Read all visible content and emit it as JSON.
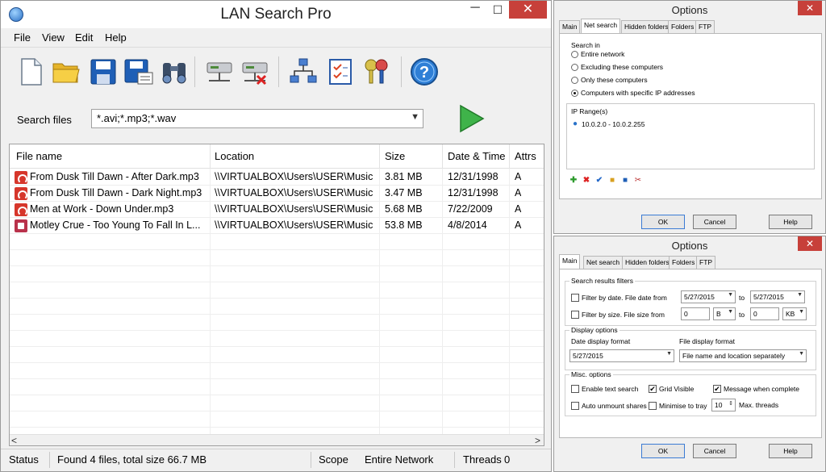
{
  "window": {
    "title": "LAN Search Pro",
    "close": "✕",
    "minimize": "─",
    "maximize": "☐"
  },
  "menu": {
    "file": "File",
    "view": "View",
    "edit": "Edit",
    "help": "Help"
  },
  "toolbar": {
    "icons": [
      "new-file-icon",
      "open-folder-icon",
      "save-icon",
      "save-as-icon",
      "find-binoculars-icon",
      "map-drive-icon",
      "disconnect-drive-icon",
      "network-icon",
      "checklist-icon",
      "keys-icon",
      "help-icon"
    ]
  },
  "search": {
    "label": "Search files",
    "value": "*.avi;*.mp3;*.wav"
  },
  "table": {
    "headers": {
      "name": "File name",
      "location": "Location",
      "size": "Size",
      "date": "Date & Time",
      "attrs": "Attrs"
    },
    "rows": [
      {
        "name": "From Dusk Till Dawn - After Dark.mp3",
        "location": "\\\\VIRTUALBOX\\Users\\USER\\Music",
        "size": "3.81 MB",
        "date": "12/31/1998",
        "attrs": "A",
        "type": "mp3"
      },
      {
        "name": "From Dusk Till Dawn - Dark Night.mp3",
        "location": "\\\\VIRTUALBOX\\Users\\USER\\Music",
        "size": "3.47 MB",
        "date": "12/31/1998",
        "attrs": "A",
        "type": "mp3"
      },
      {
        "name": "Men at Work - Down Under.mp3",
        "location": "\\\\VIRTUALBOX\\Users\\USER\\Music",
        "size": "5.68 MB",
        "date": "7/22/2009",
        "attrs": "A",
        "type": "mp3"
      },
      {
        "name": "Motley Crue - Too Young To Fall In L...",
        "location": "\\\\VIRTUALBOX\\Users\\USER\\Music",
        "size": "53.8 MB",
        "date": "4/8/2014",
        "attrs": "A",
        "type": "wav"
      }
    ]
  },
  "status": {
    "status_label": "Status",
    "status_text": "Found 4 files, total size 66.7 MB",
    "scope_label": "Scope",
    "scope_value": "Entire Network",
    "threads_label": "Threads",
    "threads_value": "0"
  },
  "dialog1": {
    "title": "Options",
    "tabs": [
      "Main",
      "Net search",
      "Hidden folders",
      "Folders",
      "FTP"
    ],
    "search_in": "Search in",
    "options": [
      "Entire network",
      "Excluding these computers",
      "Only these computers",
      "Computers with specific IP addresses"
    ],
    "ip_label": "IP Range(s)",
    "ip_range": "10.0.2.0 - 10.0.2.255",
    "ok": "OK",
    "cancel": "Cancel",
    "help": "Help"
  },
  "dialog2": {
    "title": "Options",
    "tabs": [
      "Main",
      "Net search",
      "Hidden folders",
      "Folders",
      "FTP"
    ],
    "filters_label": "Search results filters",
    "filter_date": "Filter by date. File date from",
    "date_from": "5/27/2015",
    "to1": "to",
    "date_to": "5/27/2015",
    "filter_size": "Filter by size. File size from",
    "size_from": "0",
    "unit_from": "B",
    "to2": "to",
    "size_to": "0",
    "unit_to": "KB",
    "display_label": "Display options",
    "date_format_label": "Date display format",
    "date_format_value": "5/27/2015",
    "file_format_label": "File display format",
    "file_format_value": "File name and location separately",
    "misc_label": "Misc. options",
    "enable_text": "Enable text search",
    "grid_visible": "Grid Visible",
    "message_complete": "Message when complete",
    "auto_unmount": "Auto unmount shares",
    "minimise_tray": "Minimise to tray",
    "threads_value": "10",
    "max_threads": "Max. threads",
    "ok": "OK",
    "cancel": "Cancel",
    "help": "Help"
  }
}
